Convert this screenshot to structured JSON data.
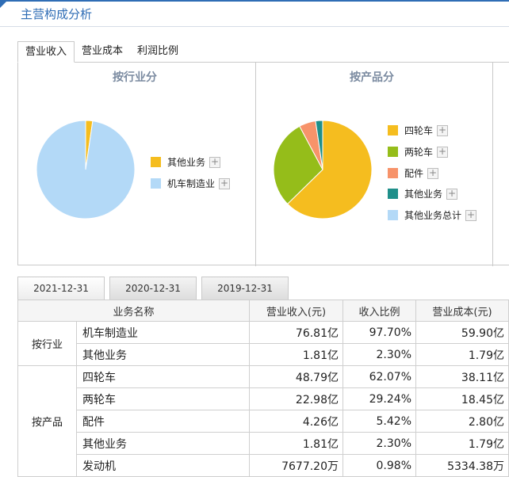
{
  "header": {
    "title": "主营构成分析",
    "accent_color": "#2f6db5"
  },
  "tabs": [
    {
      "label": "营业收入",
      "active": true
    },
    {
      "label": "营业成本",
      "active": false
    },
    {
      "label": "利润比例",
      "active": false
    }
  ],
  "industry_chart": {
    "title": "按行业分",
    "legend": [
      {
        "label": "其他业务",
        "color": "#f5bd1f",
        "plus": "+"
      },
      {
        "label": "机车制造业",
        "color": "#b3d9f7",
        "plus": "+"
      }
    ]
  },
  "product_chart": {
    "title": "按产品分",
    "legend": [
      {
        "label": "四轮车",
        "color": "#f5bd1f",
        "plus": "+"
      },
      {
        "label": "两轮车",
        "color": "#95bd1a",
        "plus": "+"
      },
      {
        "label": "配件",
        "color": "#f7936a",
        "plus": "+"
      },
      {
        "label": "其他业务",
        "color": "#1f8f8a",
        "plus": "+"
      },
      {
        "label": "其他业务总计",
        "color": "#b3d9f7",
        "plus": "+"
      }
    ]
  },
  "chart_data": [
    {
      "type": "pie",
      "title": "按行业分",
      "categories": [
        "其他业务",
        "机车制造业"
      ],
      "values": [
        2.3,
        97.7
      ],
      "colors": [
        "#f5bd1f",
        "#b3d9f7"
      ]
    },
    {
      "type": "pie",
      "title": "按产品分",
      "categories": [
        "四轮车",
        "两轮车",
        "配件",
        "其他业务"
      ],
      "values": [
        62.07,
        29.24,
        5.42,
        2.3
      ],
      "colors": [
        "#f5bd1f",
        "#95bd1a",
        "#f7936a",
        "#1f8f8a"
      ]
    }
  ],
  "year_tabs": [
    {
      "label": "2021-12-31",
      "active": true
    },
    {
      "label": "2020-12-31",
      "active": false
    },
    {
      "label": "2019-12-31",
      "active": false
    }
  ],
  "table": {
    "headers": [
      "业务名称",
      "营业收入(元)",
      "收入比例",
      "营业成本(元)"
    ],
    "groups": [
      {
        "label": "按行业",
        "rows": [
          {
            "name": "机车制造业",
            "revenue": "76.81亿",
            "ratio": "97.70%",
            "cost": "59.90亿"
          },
          {
            "name": "其他业务",
            "revenue": "1.81亿",
            "ratio": "2.30%",
            "cost": "1.79亿"
          }
        ]
      },
      {
        "label": "按产品",
        "rows": [
          {
            "name": "四轮车",
            "revenue": "48.79亿",
            "ratio": "62.07%",
            "cost": "38.11亿"
          },
          {
            "name": "两轮车",
            "revenue": "22.98亿",
            "ratio": "29.24%",
            "cost": "18.45亿"
          },
          {
            "name": "配件",
            "revenue": "4.26亿",
            "ratio": "5.42%",
            "cost": "2.80亿"
          },
          {
            "name": "其他业务",
            "revenue": "1.81亿",
            "ratio": "2.30%",
            "cost": "1.79亿"
          },
          {
            "name": "发动机",
            "revenue": "7677.20万",
            "ratio": "0.98%",
            "cost": "5334.38万"
          }
        ]
      }
    ]
  }
}
